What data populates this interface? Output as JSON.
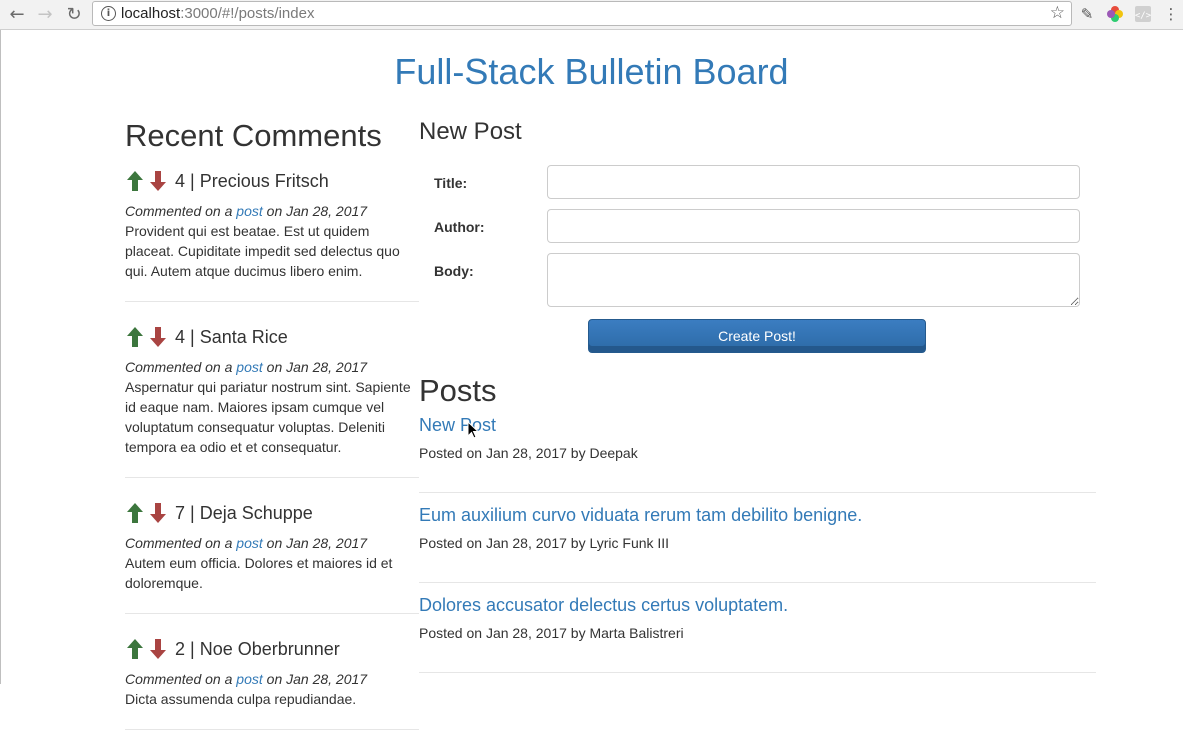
{
  "browser": {
    "url_host": "localhost",
    "url_rest": ":3000/#!/posts/index"
  },
  "page": {
    "title": "Full-Stack Bulletin Board"
  },
  "recent_comments": {
    "heading": "Recent Comments",
    "items": [
      {
        "score": "4 | Precious Fritsch",
        "meta_prefix": "Commented on a ",
        "meta_link": "post",
        "meta_suffix": " on Jan 28, 2017",
        "body": "Provident qui est beatae. Est ut quidem placeat. Cupiditate impedit sed delectus quo qui. Autem atque ducimus libero enim."
      },
      {
        "score": "4 | Santa Rice",
        "meta_prefix": "Commented on a ",
        "meta_link": "post",
        "meta_suffix": " on Jan 28, 2017",
        "body": "Aspernatur qui pariatur nostrum sint. Sapiente id eaque nam. Maiores ipsam cumque vel voluptatum consequatur voluptas. Deleniti tempora ea odio et et consequatur."
      },
      {
        "score": "7 | Deja Schuppe",
        "meta_prefix": "Commented on a ",
        "meta_link": "post",
        "meta_suffix": " on Jan 28, 2017",
        "body": "Autem eum officia. Dolores et maiores id et doloremque."
      },
      {
        "score": "2 | Noe Oberbrunner",
        "meta_prefix": "Commented on a ",
        "meta_link": "post",
        "meta_suffix": " on Jan 28, 2017",
        "body": "Dicta assumenda culpa repudiandae."
      }
    ]
  },
  "new_post": {
    "heading": "New Post",
    "title_label": "Title:",
    "author_label": "Author:",
    "body_label": "Body:",
    "title_value": "",
    "author_value": "",
    "body_value": "",
    "submit_label": "Create Post!"
  },
  "posts": {
    "heading": "Posts",
    "items": [
      {
        "title": "New Post",
        "meta": "Posted on Jan 28, 2017 by Deepak"
      },
      {
        "title": "Eum auxilium curvo viduata rerum tam debilito benigne.",
        "meta": "Posted on Jan 28, 2017 by Lyric Funk III"
      },
      {
        "title": "Dolores accusator delectus certus voluptatem.",
        "meta": "Posted on Jan 28, 2017 by Marta Balistreri"
      }
    ]
  },
  "colors": {
    "link": "#337ab7",
    "upvote": "#3c763d",
    "downvote": "#a94442",
    "button": "#337ab7"
  },
  "icons": [
    "back-arrow-icon",
    "forward-arrow-icon",
    "reload-icon",
    "info-icon",
    "star-icon",
    "eyedropper-icon",
    "color-wheel-icon",
    "code-icon",
    "menu-dots-icon",
    "upvote-arrow-icon",
    "downvote-arrow-icon",
    "mouse-cursor-icon"
  ]
}
